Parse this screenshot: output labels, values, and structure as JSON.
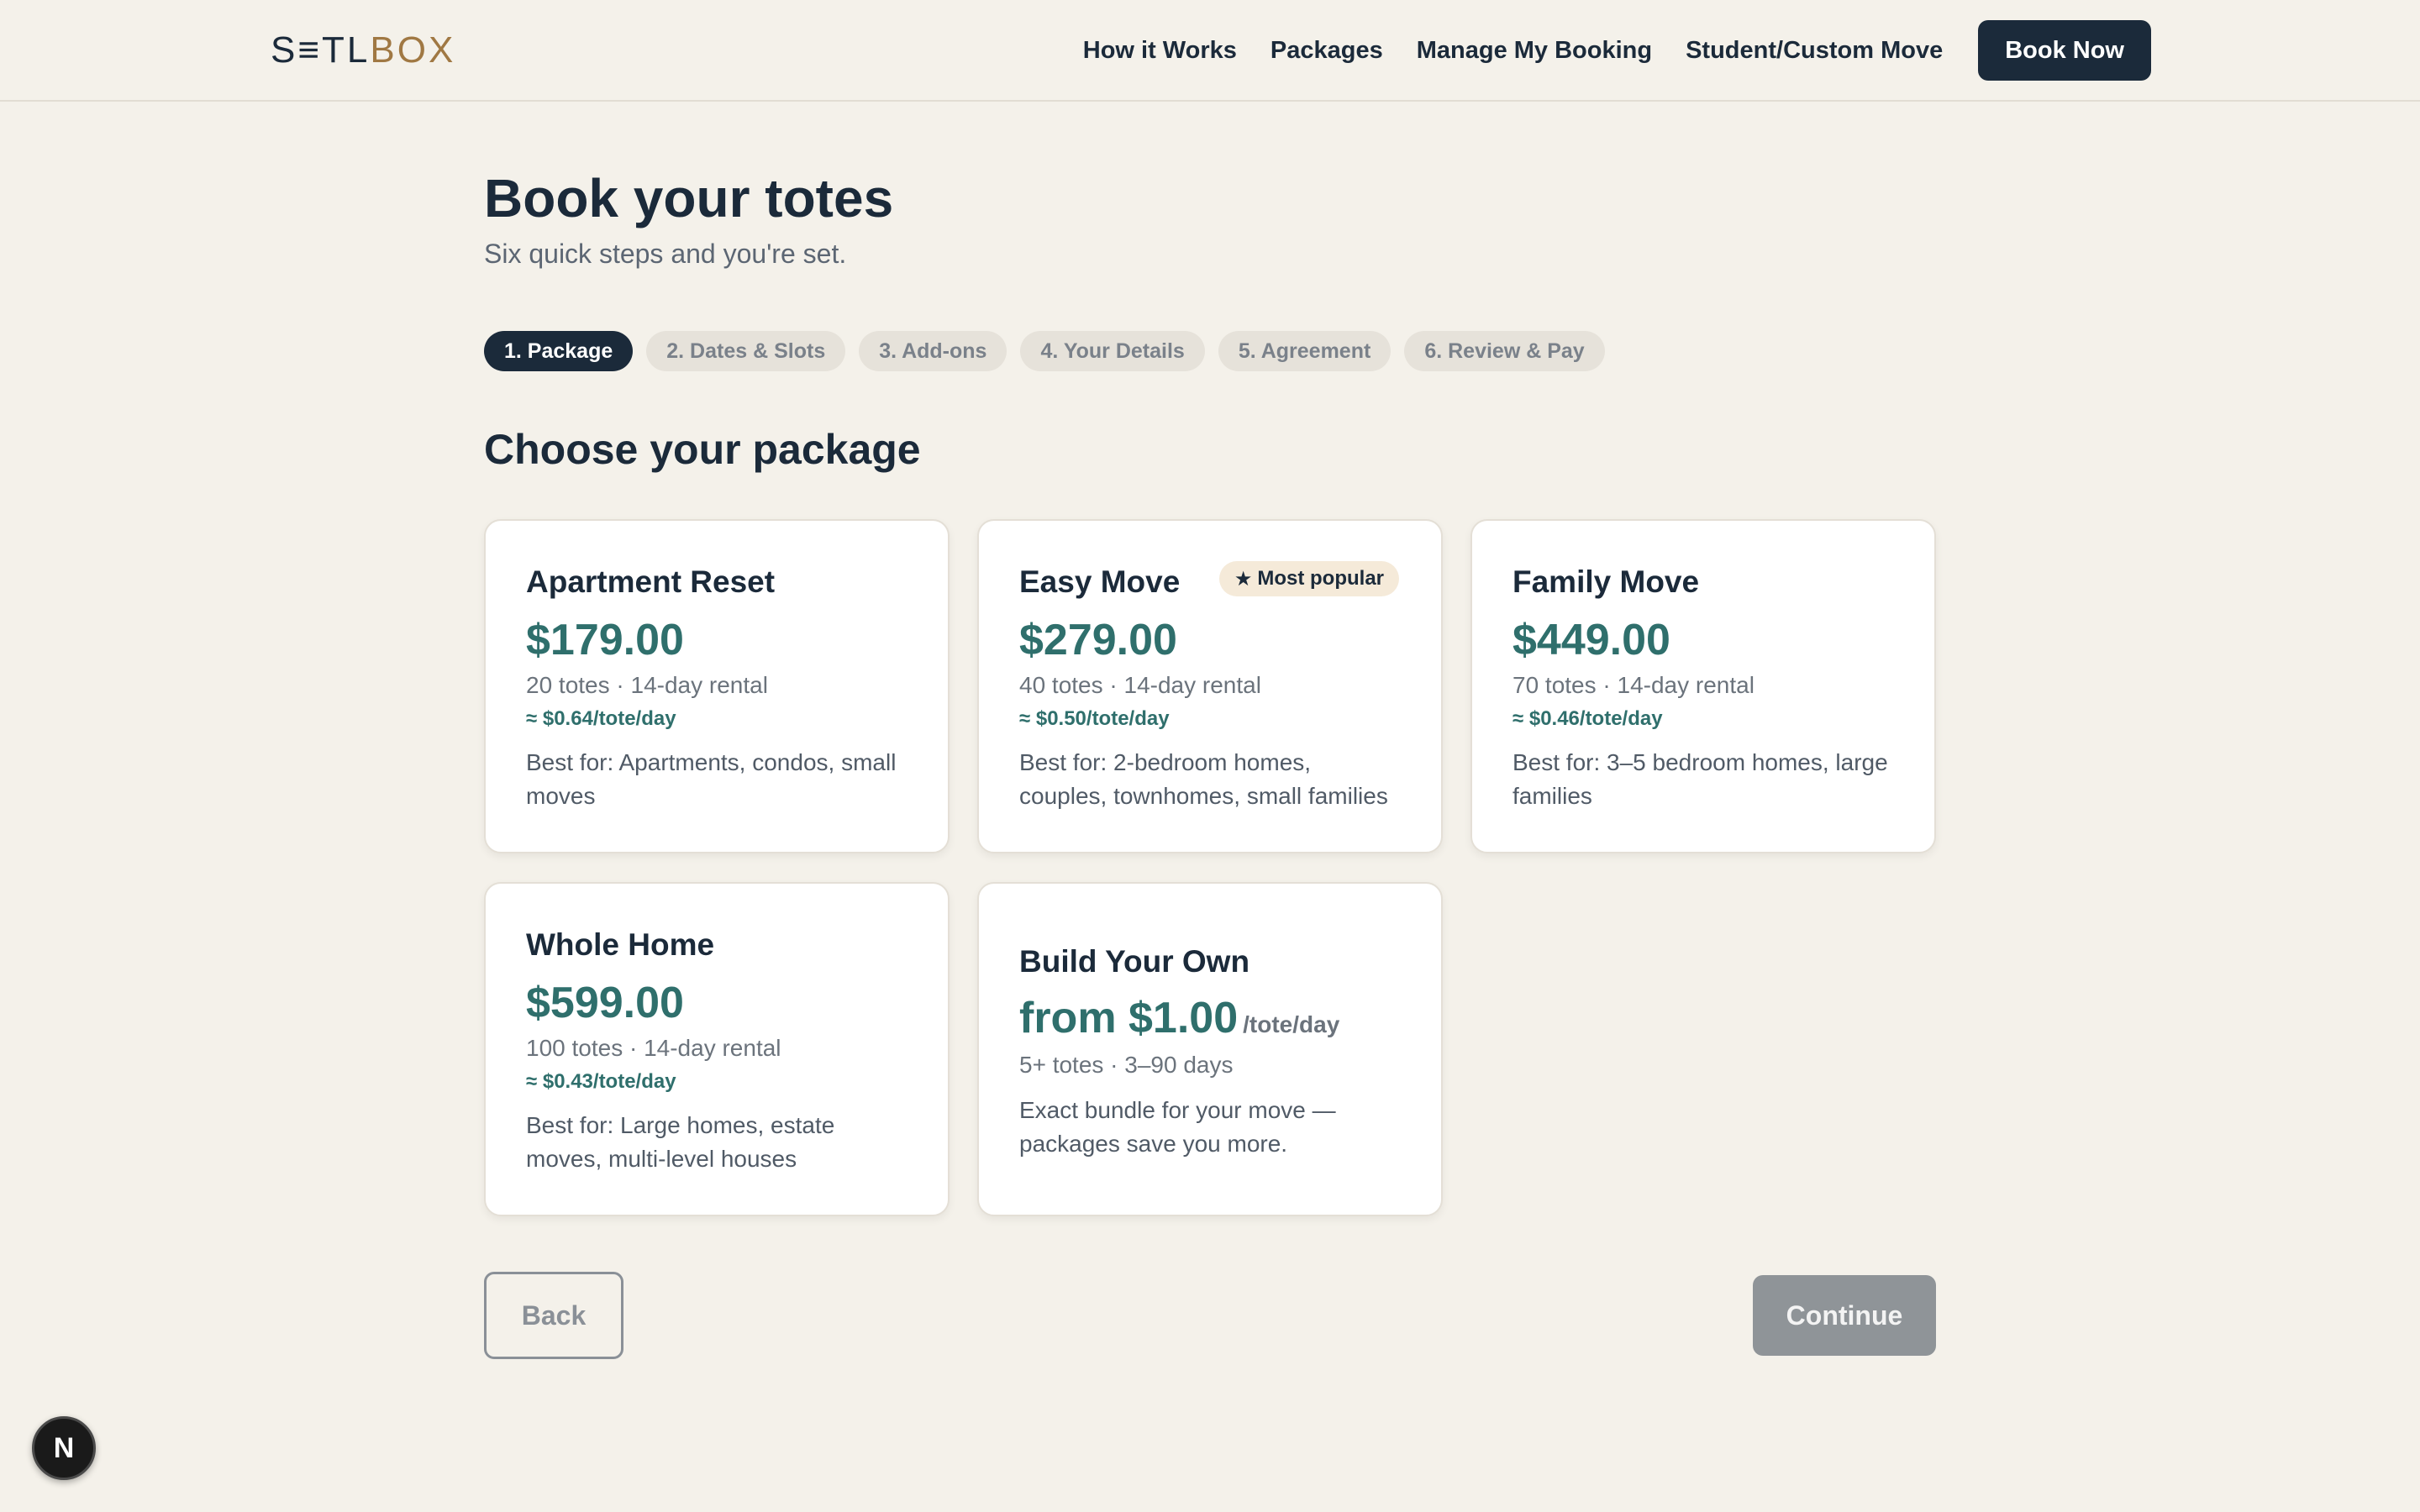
{
  "header": {
    "logo_part1": "S≡TL",
    "logo_part2": "BOX",
    "nav": [
      "How it Works",
      "Packages",
      "Manage My Booking",
      "Student/Custom Move"
    ],
    "book_now": "Book Now"
  },
  "page": {
    "title": "Book your totes",
    "subtitle": "Six quick steps and you're set."
  },
  "steps": [
    {
      "label": "1.  Package",
      "active": true
    },
    {
      "label": "2.  Dates & Slots",
      "active": false
    },
    {
      "label": "3.  Add-ons",
      "active": false
    },
    {
      "label": "4.  Your Details",
      "active": false
    },
    {
      "label": "5.  Agreement",
      "active": false
    },
    {
      "label": "6.  Review & Pay",
      "active": false
    }
  ],
  "section_title": "Choose your package",
  "packages": [
    {
      "name": "Apartment Reset",
      "price": "$179.00",
      "meta": "20 totes · 14-day rental",
      "rate": "≈ $0.64/tote/day",
      "best": "Best for: Apartments, condos, small moves"
    },
    {
      "name": "Easy Move",
      "price": "$279.00",
      "meta": "40 totes · 14-day rental",
      "rate": "≈ $0.50/tote/day",
      "best": "Best for: 2-bedroom homes, couples, townhomes, small families",
      "badge": "Most popular"
    },
    {
      "name": "Family Move",
      "price": "$449.00",
      "meta": "70 totes · 14-day rental",
      "rate": "≈ $0.46/tote/day",
      "best": "Best for: 3–5 bedroom homes, large families"
    },
    {
      "name": "Whole Home",
      "price": "$599.00",
      "meta": "100 totes · 14-day rental",
      "rate": "≈ $0.43/tote/day",
      "best": "Best for: Large homes, estate moves, multi-level houses"
    },
    {
      "name": "Build Your Own",
      "price": "from $1.00",
      "per_unit": "/tote/day",
      "meta": "5+ totes · 3–90 days",
      "best": "Exact bundle for your move — packages save you more."
    }
  ],
  "buttons": {
    "back": "Back",
    "continue": "Continue"
  },
  "dev_badge": "N",
  "icons": {
    "star": "star-icon"
  },
  "colors": {
    "navy": "#1b2a3a",
    "teal": "#2f6f6c",
    "bronze": "#a07843",
    "background": "#f4f1ea"
  }
}
